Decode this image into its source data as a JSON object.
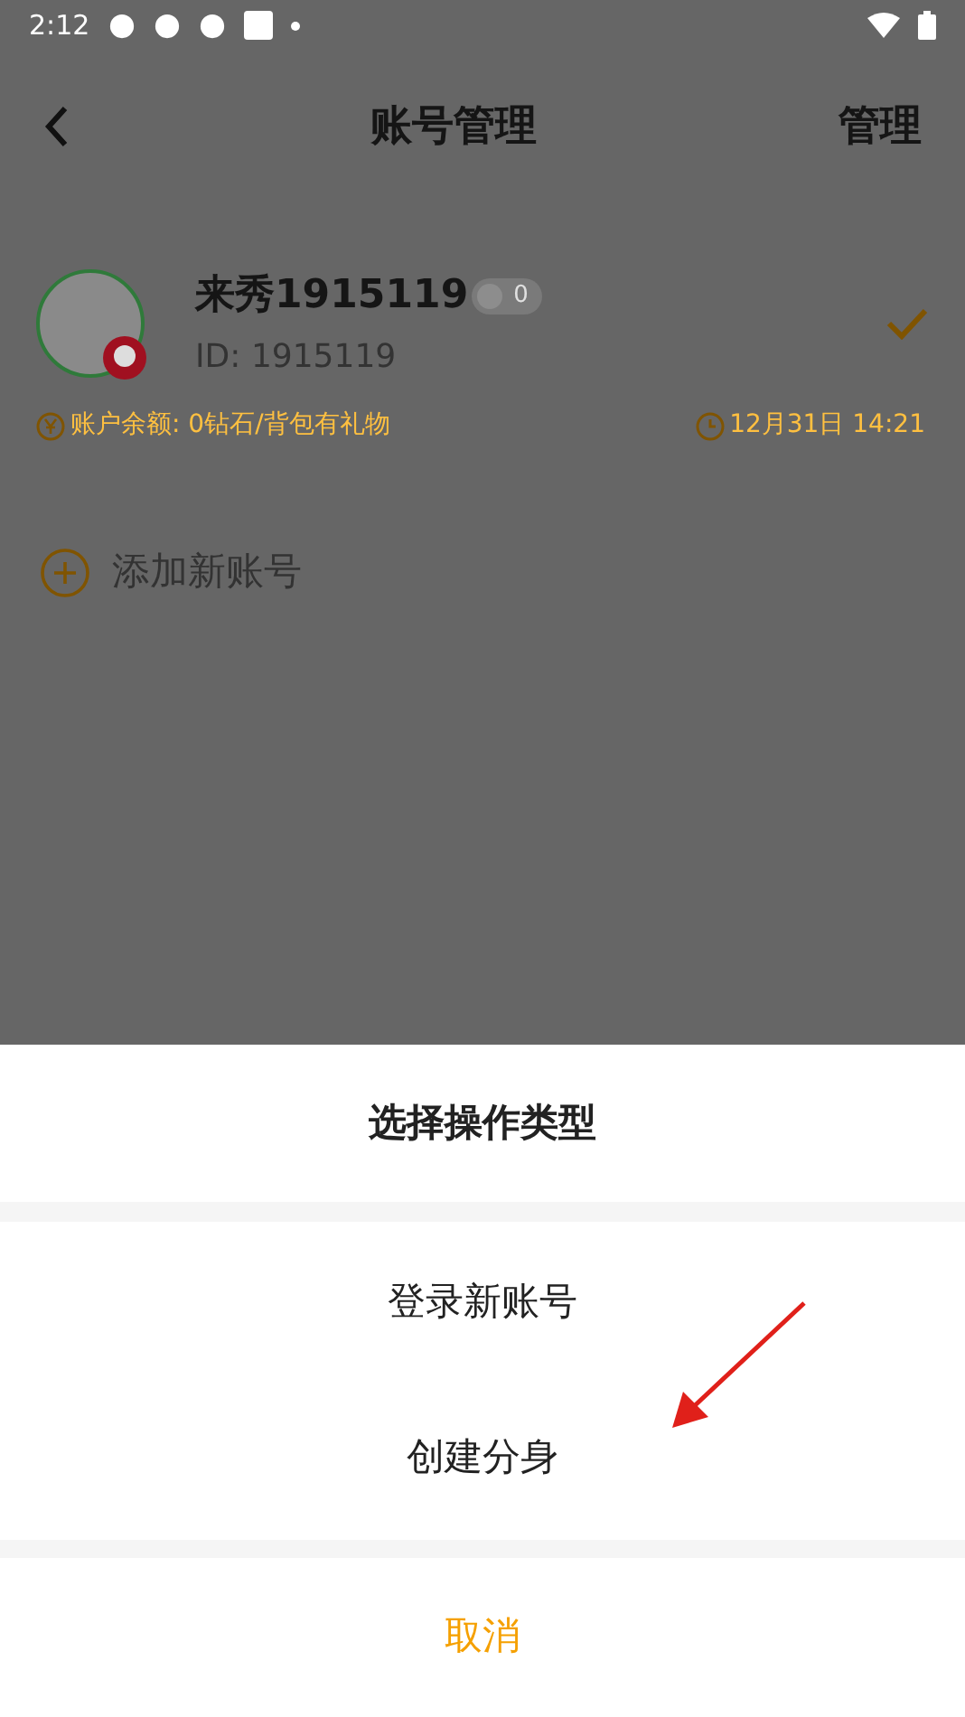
{
  "status_bar": {
    "time": "2:12"
  },
  "header": {
    "title": "账号管理",
    "action": "管理"
  },
  "accounts": [
    {
      "name": "来秀1915119",
      "badge_count": "0",
      "id": "ID: 1915119",
      "balance": "账户余额: 0钻石/背包有礼物",
      "time": "12月31日 14:21",
      "selected": true
    }
  ],
  "add_account": {
    "label": "添加新账号"
  },
  "sheet": {
    "title": "选择操作类型",
    "options": [
      "登录新账号",
      "创建分身"
    ],
    "cancel": "取消"
  }
}
